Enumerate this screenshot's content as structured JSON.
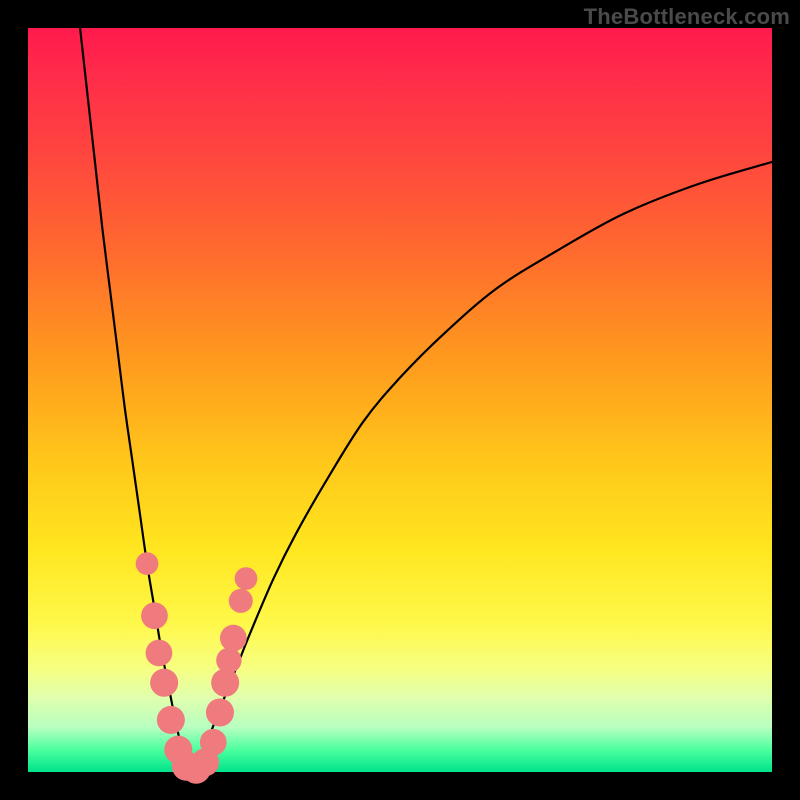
{
  "watermark": "TheBottleneck.com",
  "colors": {
    "frame": "#000000",
    "gradient_top": "#ff1a4d",
    "gradient_bottom": "#00e38c",
    "curve": "#000000",
    "marker": "#ef7b7e"
  },
  "chart_data": {
    "type": "line",
    "title": "",
    "xlabel": "",
    "ylabel": "",
    "xlim": [
      0,
      100
    ],
    "ylim": [
      0,
      100
    ],
    "description": "V-shaped bottleneck curve with minimum near x≈22. Left branch descends steeply from top-left; right branch rises with decreasing slope toward the upper-right. Pink markers cluster along both branches near the valley (y≈0–28).",
    "series": [
      {
        "name": "bottleneck_curve_left",
        "x": [
          7,
          8,
          9,
          10,
          11,
          12,
          13,
          14,
          15,
          16,
          17,
          18,
          19,
          20,
          21,
          22
        ],
        "y": [
          100,
          91,
          82,
          73,
          65,
          57,
          49,
          42,
          35,
          28,
          22,
          16,
          11,
          6,
          2,
          0
        ]
      },
      {
        "name": "bottleneck_curve_right",
        "x": [
          22,
          24,
          26,
          28,
          30,
          33,
          36,
          40,
          45,
          50,
          56,
          63,
          71,
          80,
          90,
          100
        ],
        "y": [
          0,
          4,
          9,
          14,
          19,
          26,
          32,
          39,
          47,
          53,
          59,
          65,
          70,
          75,
          79,
          82
        ]
      }
    ],
    "markers": [
      {
        "x": 16.0,
        "y": 28,
        "r": 1.1
      },
      {
        "x": 17.0,
        "y": 21,
        "r": 1.4
      },
      {
        "x": 17.6,
        "y": 16,
        "r": 1.4
      },
      {
        "x": 18.3,
        "y": 12,
        "r": 1.5
      },
      {
        "x": 19.2,
        "y": 7,
        "r": 1.5
      },
      {
        "x": 20.2,
        "y": 3,
        "r": 1.5
      },
      {
        "x": 21.3,
        "y": 0.8,
        "r": 1.6
      },
      {
        "x": 22.6,
        "y": 0.4,
        "r": 1.6
      },
      {
        "x": 23.8,
        "y": 1.3,
        "r": 1.5
      },
      {
        "x": 24.9,
        "y": 4,
        "r": 1.4
      },
      {
        "x": 25.8,
        "y": 8,
        "r": 1.5
      },
      {
        "x": 26.5,
        "y": 12,
        "r": 1.5
      },
      {
        "x": 27.0,
        "y": 15,
        "r": 1.3
      },
      {
        "x": 27.6,
        "y": 18,
        "r": 1.4
      },
      {
        "x": 28.6,
        "y": 23,
        "r": 1.2
      },
      {
        "x": 29.3,
        "y": 26,
        "r": 1.1
      }
    ]
  }
}
